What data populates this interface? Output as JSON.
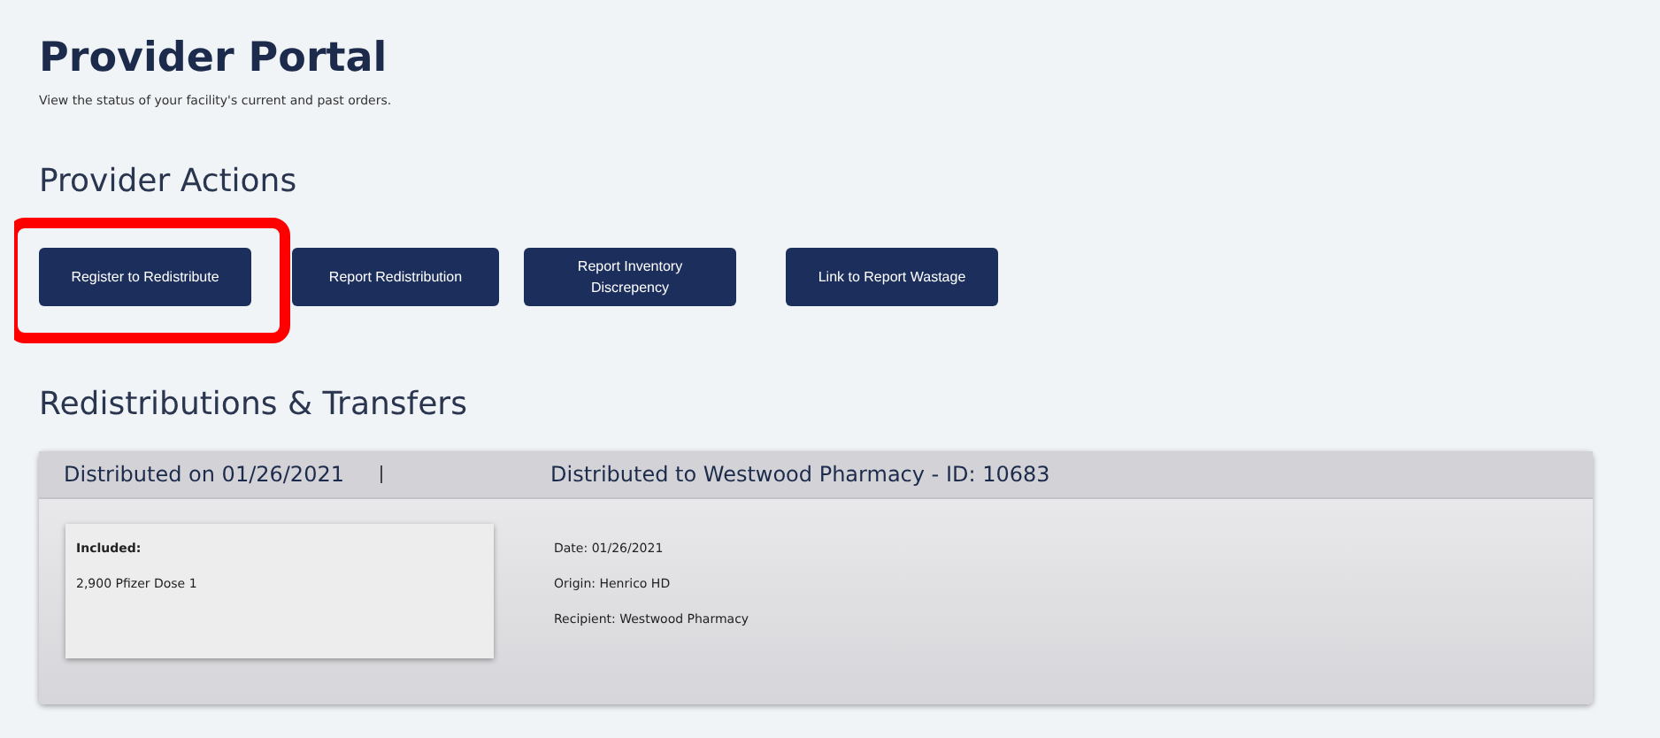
{
  "title": "Provider Portal",
  "subtitle": "View the status of your facility's current and past orders.",
  "actions_heading": "Provider Actions",
  "actions": [
    {
      "label": "Register to Redistribute",
      "highlighted": true
    },
    {
      "label": "Report Redistribution",
      "highlighted": false
    },
    {
      "label": "Report Inventory Discrepency",
      "highlighted": false
    },
    {
      "label": "Link to Report Wastage",
      "highlighted": false
    }
  ],
  "transfers_heading": "Redistributions & Transfers",
  "transfers": [
    {
      "distributed_on": "Distributed on 01/26/2021",
      "distributed_to": "Distributed to Westwood Pharmacy - ID: 10683",
      "included_label": "Included:",
      "included_items": [
        "2,900 Pfizer Dose 1"
      ],
      "details": [
        "Date: 01/26/2021",
        "Origin: Henrico HD",
        "Recipient: Westwood Pharmacy"
      ]
    }
  ]
}
